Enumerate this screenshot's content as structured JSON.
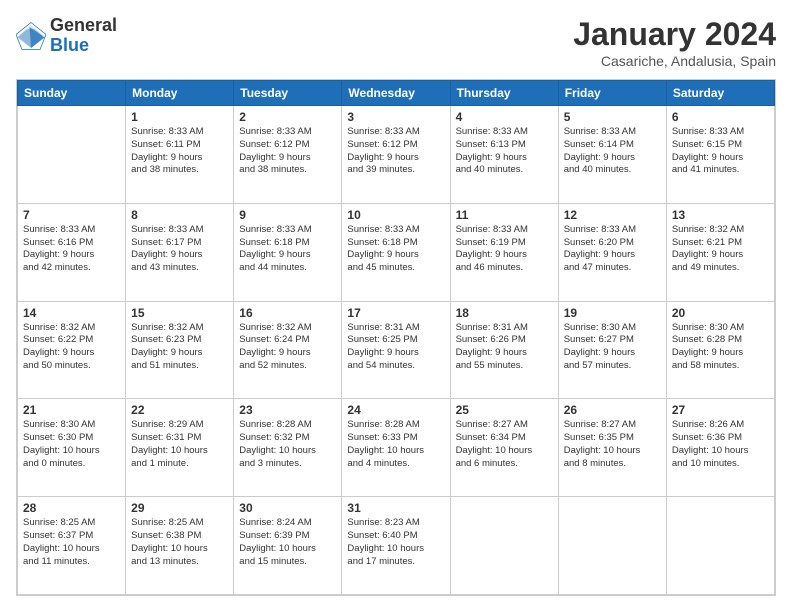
{
  "logo": {
    "general": "General",
    "blue": "Blue"
  },
  "title": "January 2024",
  "subtitle": "Casariche, Andalusia, Spain",
  "days_header": [
    "Sunday",
    "Monday",
    "Tuesday",
    "Wednesday",
    "Thursday",
    "Friday",
    "Saturday"
  ],
  "weeks": [
    [
      {
        "day": "",
        "info": ""
      },
      {
        "day": "1",
        "info": "Sunrise: 8:33 AM\nSunset: 6:11 PM\nDaylight: 9 hours\nand 38 minutes."
      },
      {
        "day": "2",
        "info": "Sunrise: 8:33 AM\nSunset: 6:12 PM\nDaylight: 9 hours\nand 38 minutes."
      },
      {
        "day": "3",
        "info": "Sunrise: 8:33 AM\nSunset: 6:12 PM\nDaylight: 9 hours\nand 39 minutes."
      },
      {
        "day": "4",
        "info": "Sunrise: 8:33 AM\nSunset: 6:13 PM\nDaylight: 9 hours\nand 40 minutes."
      },
      {
        "day": "5",
        "info": "Sunrise: 8:33 AM\nSunset: 6:14 PM\nDaylight: 9 hours\nand 40 minutes."
      },
      {
        "day": "6",
        "info": "Sunrise: 8:33 AM\nSunset: 6:15 PM\nDaylight: 9 hours\nand 41 minutes."
      }
    ],
    [
      {
        "day": "7",
        "info": "Sunrise: 8:33 AM\nSunset: 6:16 PM\nDaylight: 9 hours\nand 42 minutes."
      },
      {
        "day": "8",
        "info": "Sunrise: 8:33 AM\nSunset: 6:17 PM\nDaylight: 9 hours\nand 43 minutes."
      },
      {
        "day": "9",
        "info": "Sunrise: 8:33 AM\nSunset: 6:18 PM\nDaylight: 9 hours\nand 44 minutes."
      },
      {
        "day": "10",
        "info": "Sunrise: 8:33 AM\nSunset: 6:18 PM\nDaylight: 9 hours\nand 45 minutes."
      },
      {
        "day": "11",
        "info": "Sunrise: 8:33 AM\nSunset: 6:19 PM\nDaylight: 9 hours\nand 46 minutes."
      },
      {
        "day": "12",
        "info": "Sunrise: 8:33 AM\nSunset: 6:20 PM\nDaylight: 9 hours\nand 47 minutes."
      },
      {
        "day": "13",
        "info": "Sunrise: 8:32 AM\nSunset: 6:21 PM\nDaylight: 9 hours\nand 49 minutes."
      }
    ],
    [
      {
        "day": "14",
        "info": "Sunrise: 8:32 AM\nSunset: 6:22 PM\nDaylight: 9 hours\nand 50 minutes."
      },
      {
        "day": "15",
        "info": "Sunrise: 8:32 AM\nSunset: 6:23 PM\nDaylight: 9 hours\nand 51 minutes."
      },
      {
        "day": "16",
        "info": "Sunrise: 8:32 AM\nSunset: 6:24 PM\nDaylight: 9 hours\nand 52 minutes."
      },
      {
        "day": "17",
        "info": "Sunrise: 8:31 AM\nSunset: 6:25 PM\nDaylight: 9 hours\nand 54 minutes."
      },
      {
        "day": "18",
        "info": "Sunrise: 8:31 AM\nSunset: 6:26 PM\nDaylight: 9 hours\nand 55 minutes."
      },
      {
        "day": "19",
        "info": "Sunrise: 8:30 AM\nSunset: 6:27 PM\nDaylight: 9 hours\nand 57 minutes."
      },
      {
        "day": "20",
        "info": "Sunrise: 8:30 AM\nSunset: 6:28 PM\nDaylight: 9 hours\nand 58 minutes."
      }
    ],
    [
      {
        "day": "21",
        "info": "Sunrise: 8:30 AM\nSunset: 6:30 PM\nDaylight: 10 hours\nand 0 minutes."
      },
      {
        "day": "22",
        "info": "Sunrise: 8:29 AM\nSunset: 6:31 PM\nDaylight: 10 hours\nand 1 minute."
      },
      {
        "day": "23",
        "info": "Sunrise: 8:28 AM\nSunset: 6:32 PM\nDaylight: 10 hours\nand 3 minutes."
      },
      {
        "day": "24",
        "info": "Sunrise: 8:28 AM\nSunset: 6:33 PM\nDaylight: 10 hours\nand 4 minutes."
      },
      {
        "day": "25",
        "info": "Sunrise: 8:27 AM\nSunset: 6:34 PM\nDaylight: 10 hours\nand 6 minutes."
      },
      {
        "day": "26",
        "info": "Sunrise: 8:27 AM\nSunset: 6:35 PM\nDaylight: 10 hours\nand 8 minutes."
      },
      {
        "day": "27",
        "info": "Sunrise: 8:26 AM\nSunset: 6:36 PM\nDaylight: 10 hours\nand 10 minutes."
      }
    ],
    [
      {
        "day": "28",
        "info": "Sunrise: 8:25 AM\nSunset: 6:37 PM\nDaylight: 10 hours\nand 11 minutes."
      },
      {
        "day": "29",
        "info": "Sunrise: 8:25 AM\nSunset: 6:38 PM\nDaylight: 10 hours\nand 13 minutes."
      },
      {
        "day": "30",
        "info": "Sunrise: 8:24 AM\nSunset: 6:39 PM\nDaylight: 10 hours\nand 15 minutes."
      },
      {
        "day": "31",
        "info": "Sunrise: 8:23 AM\nSunset: 6:40 PM\nDaylight: 10 hours\nand 17 minutes."
      },
      {
        "day": "",
        "info": ""
      },
      {
        "day": "",
        "info": ""
      },
      {
        "day": "",
        "info": ""
      }
    ]
  ]
}
